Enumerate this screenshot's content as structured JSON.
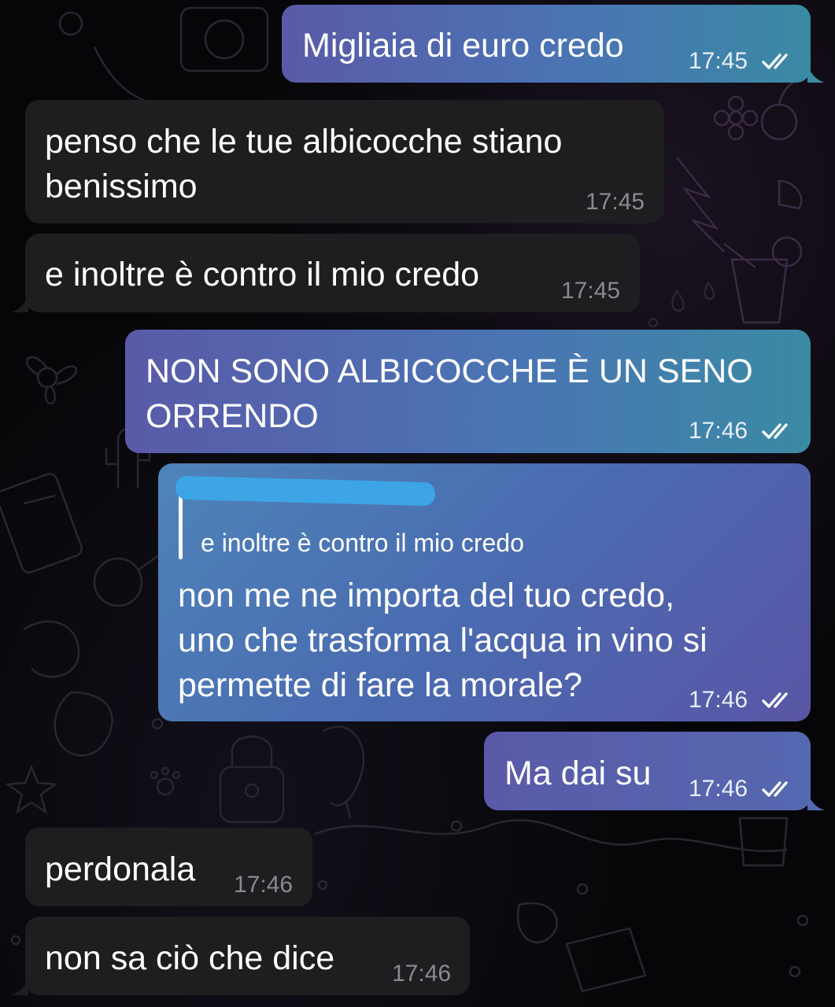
{
  "messages": [
    {
      "direction": "outgoing",
      "text": "Migliaia di euro credo",
      "time": "17:45",
      "status": "read"
    },
    {
      "direction": "incoming",
      "lines": [
        "penso che le tue albicocche stiano",
        "benissimo"
      ],
      "time": "17:45"
    },
    {
      "direction": "incoming",
      "text": "e inoltre è contro il mio credo",
      "time": "17:45"
    },
    {
      "direction": "outgoing",
      "lines": [
        "NON SONO ALBICOCCHE È UN SENO",
        "ORRENDO"
      ],
      "time": "17:46",
      "status": "read"
    },
    {
      "direction": "outgoing",
      "reply": {
        "quoted_text": "e inoltre è contro il mio credo"
      },
      "lines": [
        "non me ne importa del tuo credo,",
        "uno che trasforma l'acqua in vino si",
        "permette di fare la morale?"
      ],
      "time": "17:46",
      "status": "read"
    },
    {
      "direction": "outgoing",
      "text": "Ma dai su",
      "time": "17:46",
      "status": "read"
    },
    {
      "direction": "incoming",
      "text": "perdonala",
      "time": "17:46"
    },
    {
      "direction": "incoming",
      "text": "non sa ciò che dice",
      "time": "17:46"
    }
  ],
  "colors": {
    "incoming_bubble": "#1e1e21",
    "outgoing_gradient_start": "#5a5aa8",
    "outgoing_gradient_end": "#3a8aa4",
    "redaction": "#3da4e6",
    "background": "#060608"
  },
  "icons": {
    "read_status": "double-check-icon"
  }
}
